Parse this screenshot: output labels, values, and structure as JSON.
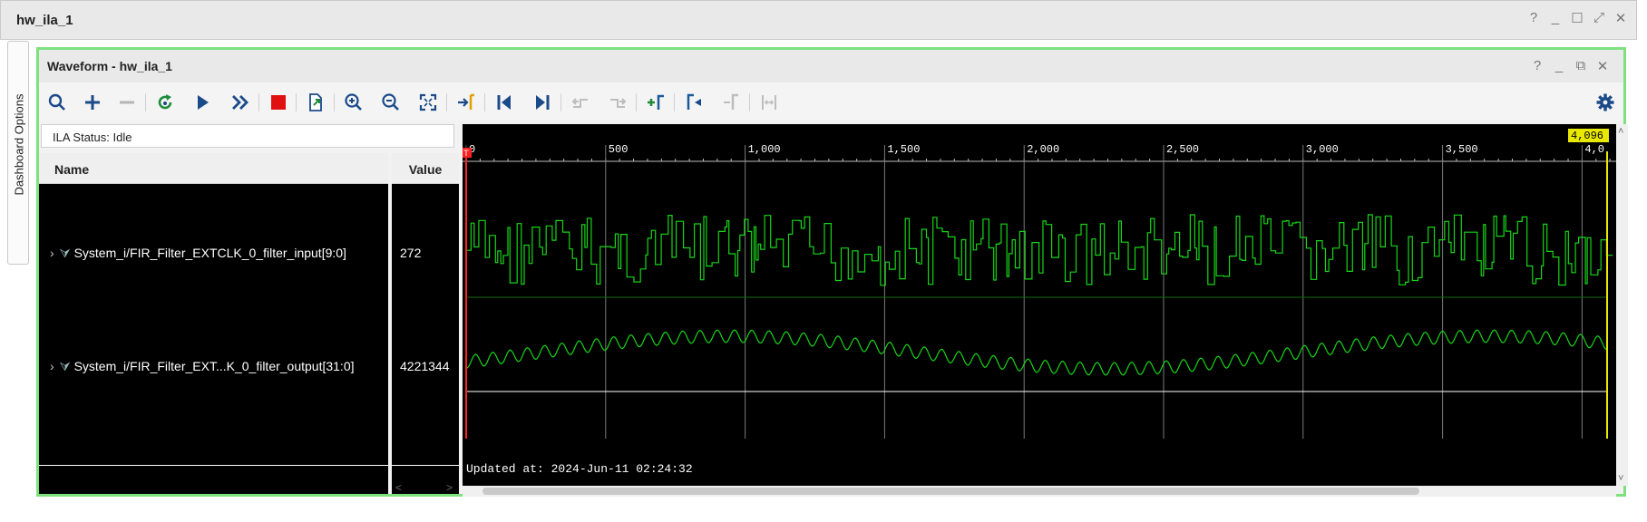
{
  "window": {
    "title": "hw_ila_1",
    "controls": [
      "?",
      "_",
      "☐",
      "⤢",
      "✕"
    ]
  },
  "side_tab": {
    "label": "Dashboard Options"
  },
  "panel": {
    "title": "Waveform - hw_ila_1",
    "controls": [
      "?",
      "_",
      "⧉",
      "✕"
    ]
  },
  "toolbar_icons": [
    "search-icon",
    "add-icon",
    "remove-icon",
    "refresh-icon",
    "run-icon",
    "run-immediate-icon",
    "stop-icon",
    "export-icon",
    "zoom-in-icon",
    "zoom-out-icon",
    "zoom-fit-icon",
    "marker-icon",
    "go-to-start-icon",
    "go-to-end-icon",
    "previous-transition-icon",
    "next-transition-icon",
    "add-marker-icon",
    "previous-marker-icon",
    "next-marker-icon",
    "swap-cursors-icon",
    "settings-icon"
  ],
  "status": {
    "label": "ILA Status:",
    "value": "Idle"
  },
  "columns": {
    "name": "Name",
    "value": "Value"
  },
  "signals": [
    {
      "name": "System_i/FIR_Filter_EXTCLK_0_filter_input[9:0]",
      "value": "272"
    },
    {
      "name": "System_i/FIR_Filter_EXT...K_0_filter_output[31:0]",
      "value": "4221344"
    }
  ],
  "waveform": {
    "ruler_ticks": [
      "0",
      "500",
      "1,000",
      "1,500",
      "2,000",
      "2,500",
      "3,000",
      "3,500",
      "4,0"
    ],
    "end_marker": "4,096",
    "trigger_marker": "T",
    "updated_at": "Updated at: 2024-Jun-11 02:24:32",
    "colors": {
      "trace": "#16d616",
      "grid": "#7a7a7a",
      "trigger": "#ff2020",
      "end_marker": "#e8e800"
    }
  }
}
